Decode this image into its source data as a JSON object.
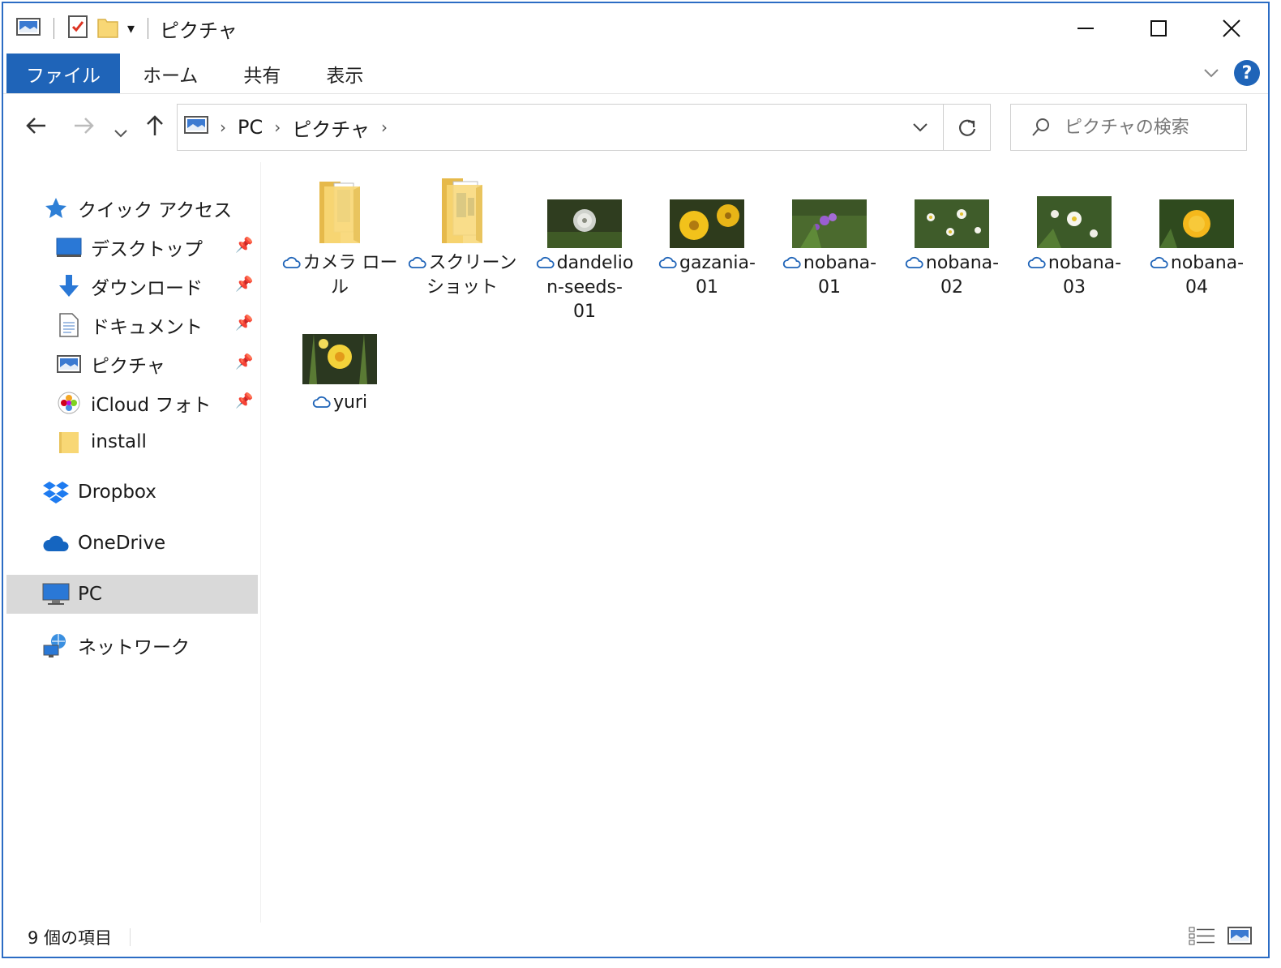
{
  "window": {
    "title": "ピクチャ"
  },
  "ribbon": {
    "tabs": [
      "ファイル",
      "ホーム",
      "共有",
      "表示"
    ],
    "help": "?"
  },
  "address": {
    "crumbs": [
      "PC",
      "ピクチャ"
    ]
  },
  "search": {
    "placeholder": "ピクチャの検索"
  },
  "sidebar": {
    "quick_access": "クイック アクセス",
    "pinned": [
      {
        "label": "デスクトップ",
        "icon": "desktop-icon"
      },
      {
        "label": "ダウンロード",
        "icon": "download-icon"
      },
      {
        "label": "ドキュメント",
        "icon": "document-icon"
      },
      {
        "label": "ピクチャ",
        "icon": "pictures-icon"
      },
      {
        "label": "iCloud フォト",
        "icon": "icloud-photos-icon"
      },
      {
        "label": "install",
        "icon": "folder-icon"
      }
    ],
    "dropbox": "Dropbox",
    "onedrive": "OneDrive",
    "pc": "PC",
    "network": "ネットワーク"
  },
  "items": [
    {
      "line1": "カメラ ロー",
      "line2": "ル",
      "line3": "",
      "type": "folder"
    },
    {
      "line1": "スクリーン",
      "line2": "ショット",
      "line3": "",
      "type": "folder"
    },
    {
      "line1": "dandelio",
      "line2": "n-seeds-",
      "line3": "01",
      "type": "image"
    },
    {
      "line1": "gazania-",
      "line2": "01",
      "line3": "",
      "type": "image"
    },
    {
      "line1": "nobana-",
      "line2": "01",
      "line3": "",
      "type": "image"
    },
    {
      "line1": "nobana-",
      "line2": "02",
      "line3": "",
      "type": "image"
    },
    {
      "line1": "nobana-",
      "line2": "03",
      "line3": "",
      "type": "image"
    },
    {
      "line1": "nobana-",
      "line2": "04",
      "line3": "",
      "type": "image"
    },
    {
      "line1": "yuri",
      "line2": "",
      "line3": "",
      "type": "image"
    }
  ],
  "status": {
    "count": "9 個の項目"
  },
  "colors": {
    "accent": "#1f64b8",
    "cloud_status": "#1f64b8",
    "selected_bg": "#d9d9d9"
  }
}
